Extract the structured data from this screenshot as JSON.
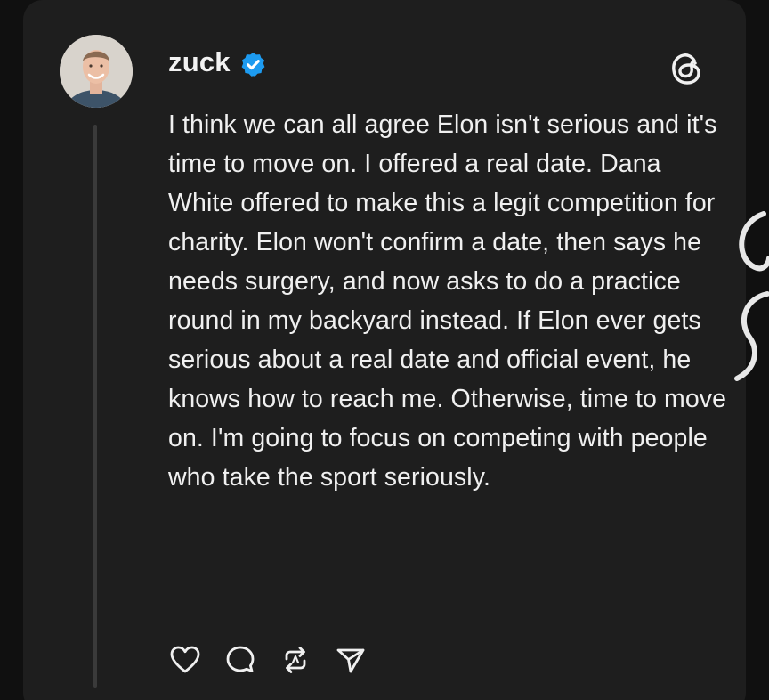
{
  "post": {
    "username": "zuck",
    "verified": true,
    "text": "I think we can all agree Elon isn't serious and it's time to move on. I offered a real date. Dana White offered to make this a legit competition for charity. Elon won't confirm a date, then says he needs surgery, and now asks to do a practice round in my backyard instead. If Elon ever gets serious about a real date and official event, he knows how to reach me. Otherwise, time to move on. I'm going to focus on competing with people who take the sport seriously."
  },
  "icons": {
    "avatar": "profile-photo",
    "verified": "verified-badge-icon",
    "app_logo": "threads-logo-icon",
    "like": "heart-icon",
    "reply": "comment-bubble-icon",
    "repost": "repost-arrows-icon",
    "share": "send-paper-plane-icon"
  },
  "colors": {
    "card_background": "#1e1e1e",
    "page_background": "#101010",
    "text": "#f0f0f0",
    "verified_blue": "#1d9bf0",
    "thread_line": "#3a3a3a"
  }
}
